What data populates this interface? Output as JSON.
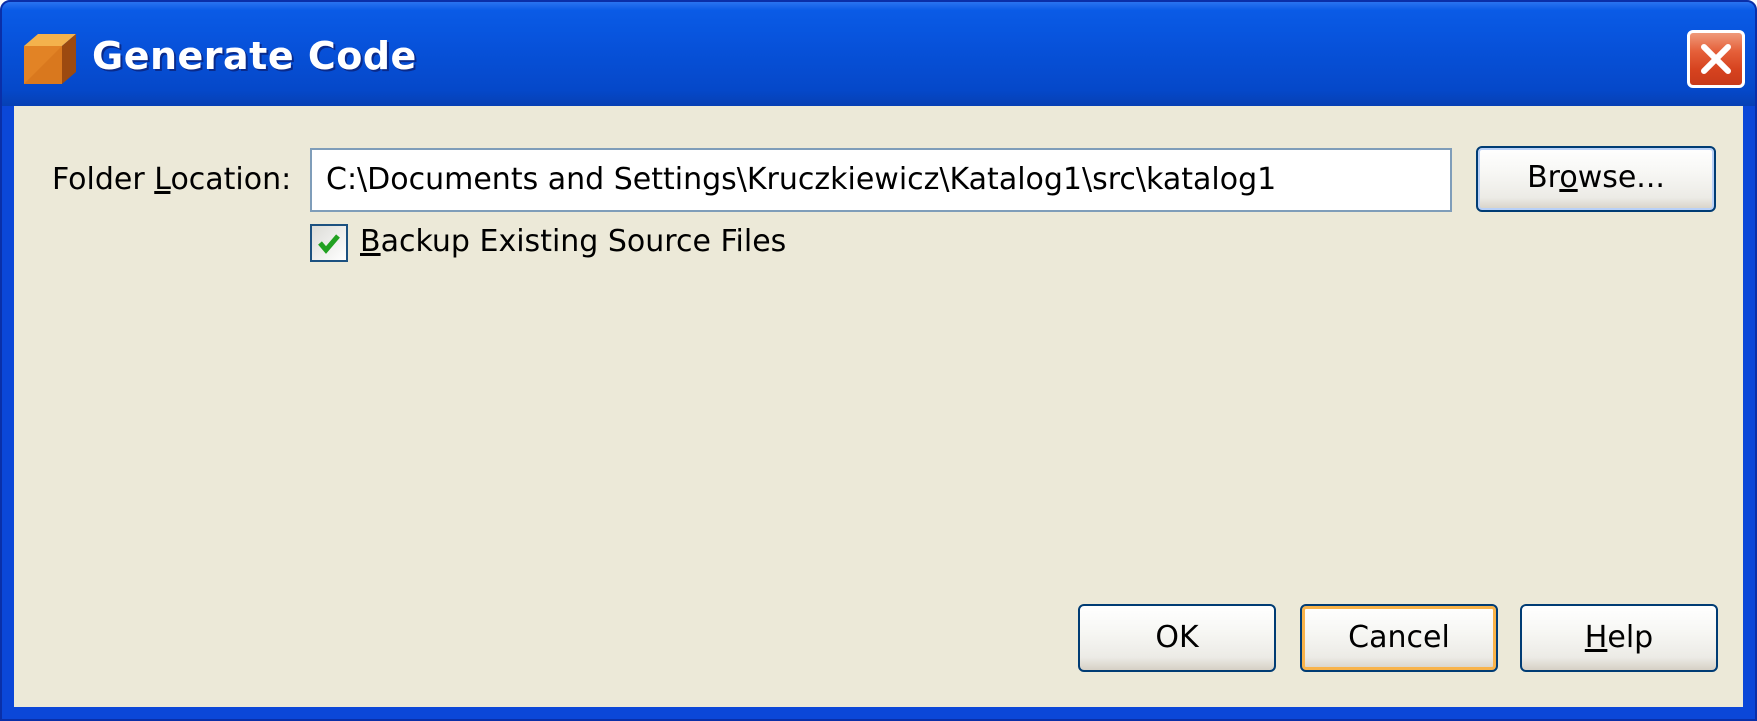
{
  "window": {
    "title": "Generate Code",
    "icon": "app-cube-icon",
    "close_icon": "close-icon"
  },
  "form": {
    "folder_label_pre": "Folder ",
    "folder_label_mnemonic": "L",
    "folder_label_post": "ocation:",
    "folder_value": "C:\\Documents and Settings\\Kruczkiewicz\\Katalog1\\src\\katalog1",
    "browse_pre": "Br",
    "browse_mnemonic": "o",
    "browse_post": "wse...",
    "backup_mnemonic": "B",
    "backup_post": "ackup Existing Source Files",
    "backup_checked": true
  },
  "buttons": {
    "ok": "OK",
    "cancel": "Cancel",
    "help_mnemonic": "H",
    "help_post": "elp"
  },
  "colors": {
    "titlebar": "#0751d9",
    "client_background": "#ece9d8",
    "button_border": "#003c74",
    "focus_ring": "#f8b34a",
    "check_mark": "#21a121"
  }
}
